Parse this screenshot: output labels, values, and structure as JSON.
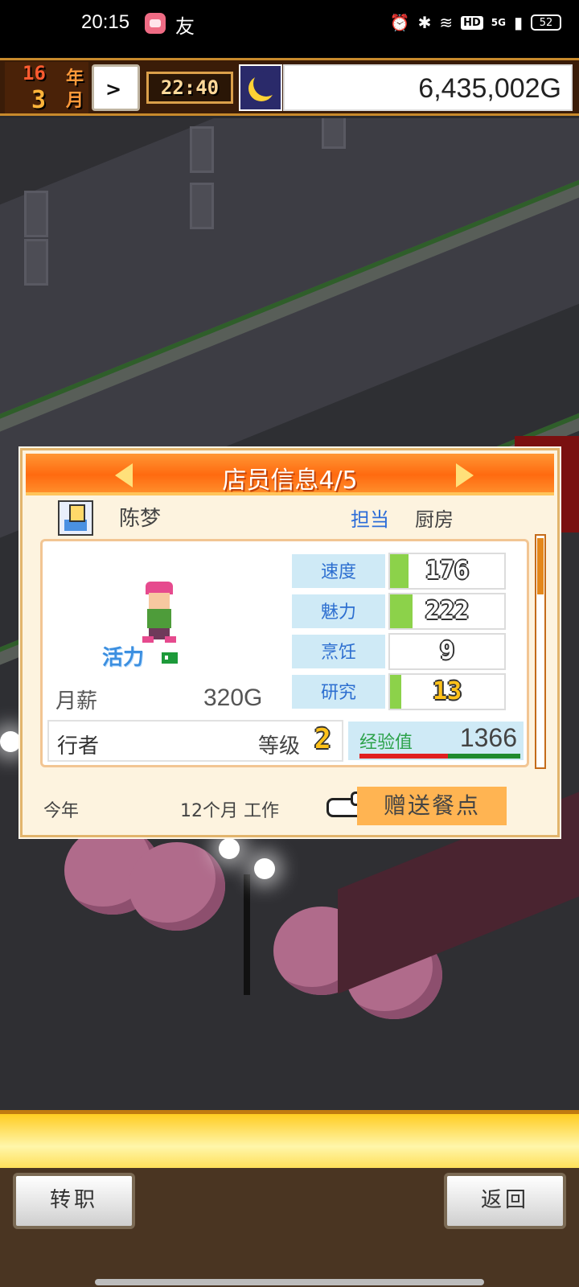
{
  "status_bar": {
    "time": "20:15",
    "app_char": "友",
    "hd": "HD",
    "network": "5G",
    "battery": "52",
    "icons": [
      "alarm-icon",
      "bluetooth-icon",
      "wifi-icon",
      "signal-icon"
    ]
  },
  "hud": {
    "year": "16",
    "year_unit": "年",
    "month": "3",
    "month_unit": "月",
    "clock_time": "22:40",
    "money": "6,435,002G"
  },
  "dialog": {
    "title": "店员信息4/5",
    "employee_name": "陈梦",
    "assignment_label": "担当",
    "assignment_value": "厨房",
    "vitality": "活力",
    "salary_label": "月薪",
    "salary_value": "320G",
    "stats": [
      {
        "label": "速度",
        "value": "176",
        "fill": 0.16,
        "style": "white"
      },
      {
        "label": "魅力",
        "value": "222",
        "fill": 0.2,
        "style": "white"
      },
      {
        "label": "烹饪",
        "value": "9",
        "fill": 0.0,
        "style": "white"
      },
      {
        "label": "研究",
        "value": "13",
        "fill": 0.1,
        "style": "gold"
      }
    ],
    "job_name": "行者",
    "level_label": "等级",
    "level_value": "2",
    "exp_label": "经验值",
    "exp_value": "1366",
    "exp_fill": 0.55,
    "footer_year": "今年",
    "footer_work": "12个月 工作",
    "gift_button": "赠送餐点"
  },
  "bottom": {
    "left_button": "转职",
    "right_button": "返回"
  },
  "colors": {
    "header_orange": "#ff6a10",
    "stat_label_bg": "#cfeaf6",
    "stat_bar": "#8cd24a",
    "gift_button": "#ffb452"
  }
}
